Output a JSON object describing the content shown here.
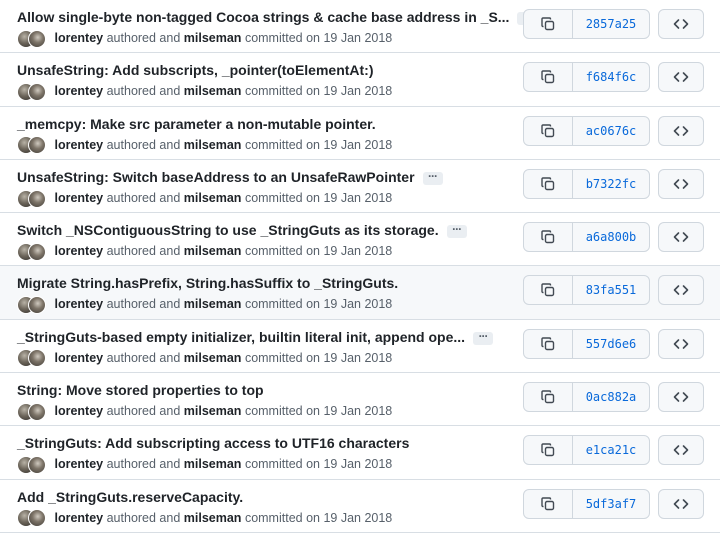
{
  "commits": [
    {
      "title": "Allow single-byte non-tagged Cocoa strings & cache base address in _S...",
      "has_more": true,
      "author": "lorentey",
      "committer": "milseman",
      "authored_text": "authored and",
      "committed_text": "committed on 19 Jan 2018",
      "sha": "2857a25"
    },
    {
      "title": "UnsafeString: Add subscripts, _pointer(toElementAt:)",
      "has_more": false,
      "author": "lorentey",
      "committer": "milseman",
      "authored_text": "authored and",
      "committed_text": "committed on 19 Jan 2018",
      "sha": "f684f6c"
    },
    {
      "title": "_memcpy: Make src parameter a non-mutable pointer.",
      "has_more": false,
      "author": "lorentey",
      "committer": "milseman",
      "authored_text": "authored and",
      "committed_text": "committed on 19 Jan 2018",
      "sha": "ac0676c"
    },
    {
      "title": "UnsafeString: Switch baseAddress to an UnsafeRawPointer",
      "has_more": true,
      "author": "lorentey",
      "committer": "milseman",
      "authored_text": "authored and",
      "committed_text": "committed on 19 Jan 2018",
      "sha": "b7322fc"
    },
    {
      "title": "Switch _NSContiguousString to use _StringGuts as its storage.",
      "has_more": true,
      "author": "lorentey",
      "committer": "milseman",
      "authored_text": "authored and",
      "committed_text": "committed on 19 Jan 2018",
      "sha": "a6a800b"
    },
    {
      "title": "Migrate String.hasPrefix, String.hasSuffix to _StringGuts.",
      "has_more": false,
      "author": "lorentey",
      "committer": "milseman",
      "authored_text": "authored and",
      "committed_text": "committed on 19 Jan 2018",
      "sha": "83fa551"
    },
    {
      "title": "_StringGuts-based empty initializer, builtin literal init, append ope...",
      "has_more": true,
      "author": "lorentey",
      "committer": "milseman",
      "authored_text": "authored and",
      "committed_text": "committed on 19 Jan 2018",
      "sha": "557d6e6"
    },
    {
      "title": "String: Move stored properties to top",
      "has_more": false,
      "author": "lorentey",
      "committer": "milseman",
      "authored_text": "authored and",
      "committed_text": "committed on 19 Jan 2018",
      "sha": "0ac882a"
    },
    {
      "title": "_StringGuts: Add subscripting access to UTF16 characters",
      "has_more": false,
      "author": "lorentey",
      "committer": "milseman",
      "authored_text": "authored and",
      "committed_text": "committed on 19 Jan 2018",
      "sha": "e1ca21c"
    },
    {
      "title": "Add _StringGuts.reserveCapacity.",
      "has_more": false,
      "author": "lorentey",
      "committer": "milseman",
      "authored_text": "authored and",
      "committed_text": "committed on 19 Jan 2018",
      "sha": "5df3af7"
    }
  ],
  "ellipsis_text": "···",
  "icons": {
    "copy": "copy-icon",
    "browse": "code-icon"
  },
  "colors": {
    "sha_link": "#0969da",
    "muted": "#57606a",
    "border": "#d0d7de",
    "hover_row": "#f6f8fa"
  },
  "hovered_row_index": 5
}
